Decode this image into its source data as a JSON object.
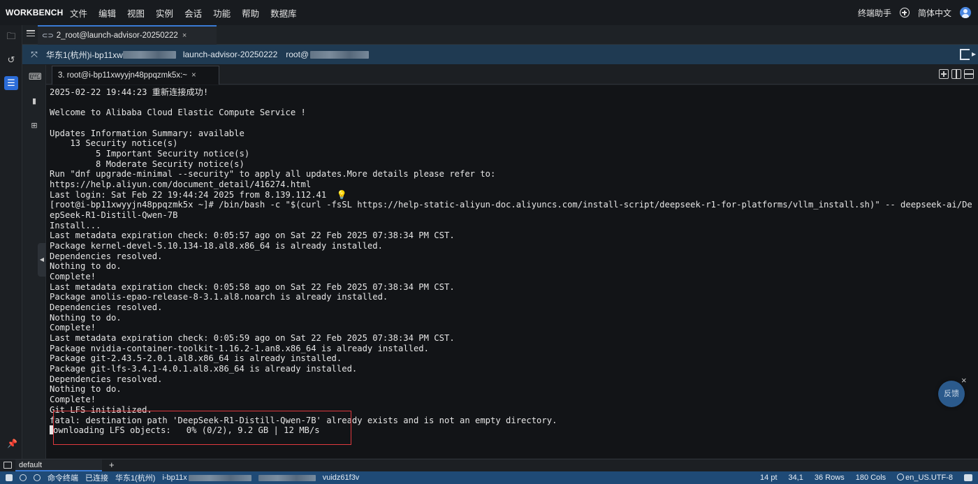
{
  "app": {
    "brand": "WORKBENCH",
    "menu": [
      "文件",
      "编辑",
      "视图",
      "实例",
      "会话",
      "功能",
      "帮助",
      "数据库"
    ],
    "topright": {
      "assistant": "终端助手",
      "language": "简体中文"
    }
  },
  "session_tab": {
    "label": "2_root@launch-advisor-20250222",
    "close": "×"
  },
  "infobar": {
    "region_prefix": "华东1(杭州)i-bp11xw",
    "instance_name": "launch-advisor-20250222",
    "user_prefix": "root@"
  },
  "terminal_tab": {
    "label": "3. root@i-bp11xwyyjn48ppqzmk5x:~",
    "close": "×"
  },
  "terminal": {
    "lines": [
      "2025-02-22 19:44:23 重新连接成功!",
      "",
      "Welcome to Alibaba Cloud Elastic Compute Service !",
      "",
      "Updates Information Summary: available",
      "    13 Security notice(s)",
      "         5 Important Security notice(s)",
      "         8 Moderate Security notice(s)",
      "Run \"dnf upgrade-minimal --security\" to apply all updates.More details please refer to:",
      "https://help.aliyun.com/document_detail/416274.html",
      "Last login: Sat Feb 22 19:44:24 2025 from 8.139.112.41",
      "[root@i-bp11xwyyjn48ppqzmk5x ~]# /bin/bash -c \"$(curl -fsSL https://help-static-aliyun-doc.aliyuncs.com/install-script/deepseek-r1-for-platforms/vllm_install.sh)\" -- deepseek-ai/De",
      "epSeek-R1-Distill-Qwen-7B",
      "Install...",
      "Last metadata expiration check: 0:05:57 ago on Sat 22 Feb 2025 07:38:34 PM CST.",
      "Package kernel-devel-5.10.134-18.al8.x86_64 is already installed.",
      "Dependencies resolved.",
      "Nothing to do.",
      "Complete!",
      "Last metadata expiration check: 0:05:58 ago on Sat 22 Feb 2025 07:38:34 PM CST.",
      "Package anolis-epao-release-8-3.1.al8.noarch is already installed.",
      "Dependencies resolved.",
      "Nothing to do.",
      "Complete!",
      "Last metadata expiration check: 0:05:59 ago on Sat 22 Feb 2025 07:38:34 PM CST.",
      "Package nvidia-container-toolkit-1.16.2-1.an8.x86_64 is already installed.",
      "Package git-2.43.5-2.0.1.al8.x86_64 is already installed.",
      "Package git-lfs-3.4.1-4.0.1.al8.x86_64 is already installed.",
      "Dependencies resolved.",
      "Nothing to do.",
      "Complete!",
      "Git LFS initialized.",
      "fatal: destination path 'DeepSeek-R1-Distill-Qwen-7B' already exists and is not an empty directory.",
      "ownloading LFS objects:   0% (0/2), 9.2 GB | 12 MB/s"
    ],
    "cursor_line_index": 33
  },
  "feedback": {
    "label": "反馈",
    "close": "×"
  },
  "bottom_panel": {
    "tab_label": "default",
    "add": "+"
  },
  "statusbar": {
    "terminal_mode": "命令终端",
    "connection": "已连接",
    "region": "华东1(杭州)",
    "instance_prefix": "i-bp11x",
    "vuid": "vuidz61f3v",
    "font_size": "14 pt",
    "cursor_pos": "34,1",
    "rows": "36 Rows",
    "cols": "180 Cols",
    "encoding": "en_US.UTF-8"
  },
  "colors": {
    "accent": "#3a7bd5",
    "highlight_box": "#e0393e",
    "statusbar": "#1f4a76"
  },
  "icons": [
    "folder-icon",
    "history-icon",
    "instances-icon",
    "terminal-icon",
    "file-icon",
    "apps-icon",
    "pin-icon",
    "list-icon",
    "expand-icon",
    "exit-icon",
    "split-icons"
  ]
}
